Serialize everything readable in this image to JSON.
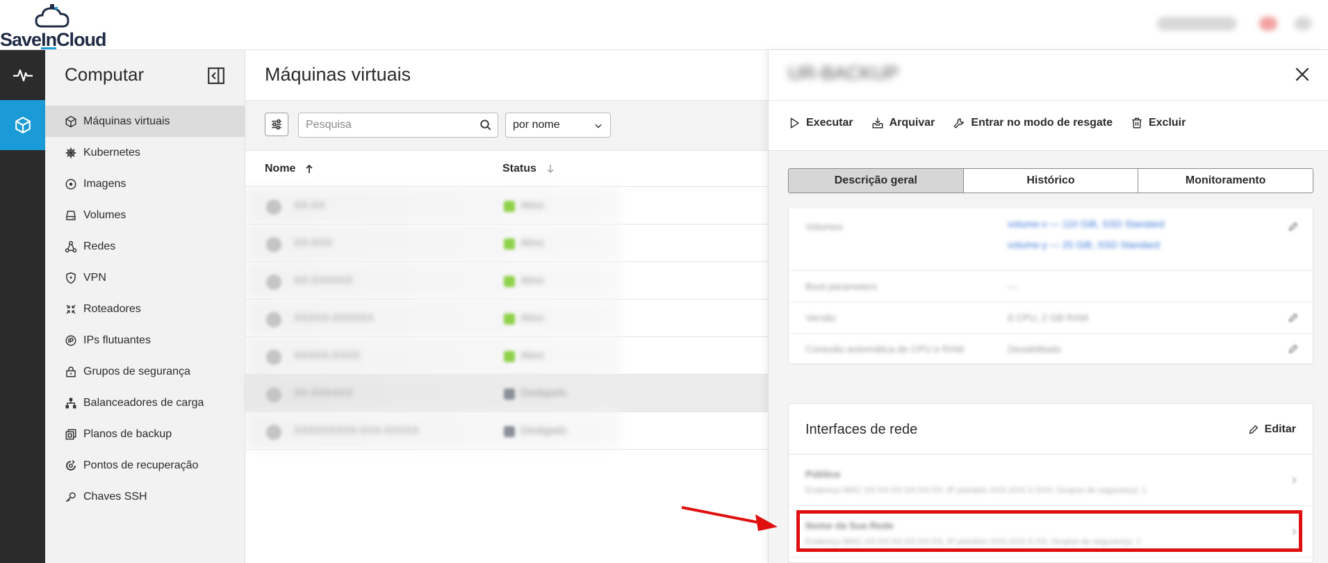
{
  "brand": {
    "name_part1": "Save",
    "name_part2": "In",
    "name_part3": "Cloud"
  },
  "sidebar": {
    "title": "Computar",
    "items": [
      {
        "label": "Máquinas virtuais",
        "icon": "cube-icon",
        "active": true
      },
      {
        "label": "Kubernetes",
        "icon": "helm-icon"
      },
      {
        "label": "Imagens",
        "icon": "disc-icon"
      },
      {
        "label": "Volumes",
        "icon": "drive-icon"
      },
      {
        "label": "Redes",
        "icon": "network-icon"
      },
      {
        "label": "VPN",
        "icon": "shield-icon"
      },
      {
        "label": "Roteadores",
        "icon": "router-icon"
      },
      {
        "label": "IPs flutuantes",
        "icon": "ip-icon"
      },
      {
        "label": "Grupos de segurança",
        "icon": "lock-icon"
      },
      {
        "label": "Balanceadores de carga",
        "icon": "balancer-icon"
      },
      {
        "label": "Planos de backup",
        "icon": "backup-icon"
      },
      {
        "label": "Pontos de recuperação",
        "icon": "restore-icon"
      },
      {
        "label": "Chaves SSH",
        "icon": "key-icon"
      }
    ]
  },
  "main": {
    "title": "Máquinas virtuais",
    "search_placeholder": "Pesquisa",
    "sort_select": "por nome",
    "columns": {
      "name": "Nome",
      "status": "Status"
    },
    "rows": [
      {
        "name": "XX-XX",
        "status": "Ativo",
        "status_color": "#8ed14a"
      },
      {
        "name": "XX-XXX",
        "status": "Ativo",
        "status_color": "#8ed14a"
      },
      {
        "name": "XX-XXXXXX",
        "status": "Ativo",
        "status_color": "#8ed14a"
      },
      {
        "name": "XXXXX-XXXXXX",
        "status": "Ativo",
        "status_color": "#8ed14a"
      },
      {
        "name": "XXXXX-XXXX",
        "status": "Ativo",
        "status_color": "#8ed14a"
      },
      {
        "name": "XX-XXXXXX",
        "status": "Desligado",
        "status_color": "#8a8f98",
        "selected": true
      },
      {
        "name": "XXXXXXXXX-XXX-XXXXX",
        "status": "Desligado",
        "status_color": "#8a8f98"
      }
    ]
  },
  "panel": {
    "title": "UR-BACKUP",
    "actions": {
      "run": "Executar",
      "archive": "Arquivar",
      "rescue": "Entrar no modo de resgate",
      "delete": "Excluir"
    },
    "tabs": {
      "overview": "Descrição geral",
      "history": "Histórico",
      "monitoring": "Monitoramento"
    },
    "details": [
      {
        "key": "Volumes",
        "value": "volume-x — 110 GiB, SSD Standard",
        "value2": "volume-y — 25 GiB, SSD Standard"
      },
      {
        "key": "Boot parameters",
        "value": "—"
      },
      {
        "key": "Versão",
        "value": "8 CPU, 2 GB RAM"
      },
      {
        "key": "Conexão automática de CPU e RAM",
        "value": "Desabilitado"
      }
    ],
    "network": {
      "title": "Interfaces de rede",
      "edit_label": "Editar",
      "interfaces": [
        {
          "name": "Pública",
          "details": "Endereço MAC XX:XX:XX:XX:XX:XX; IP primário XXX.XXX.X.XXX; Grupos de segurança: 1"
        },
        {
          "name": "Nome da Sua Rede",
          "details": "Endereço MAC XX:XX:XX:XX:XX:XX; IP primário XXX.XXX.X.XX; Grupos de segurança: 1"
        }
      ]
    }
  },
  "colors": {
    "accent": "#1a9ad6",
    "rail": "#2b2b2b",
    "highlight": "#e01010"
  }
}
